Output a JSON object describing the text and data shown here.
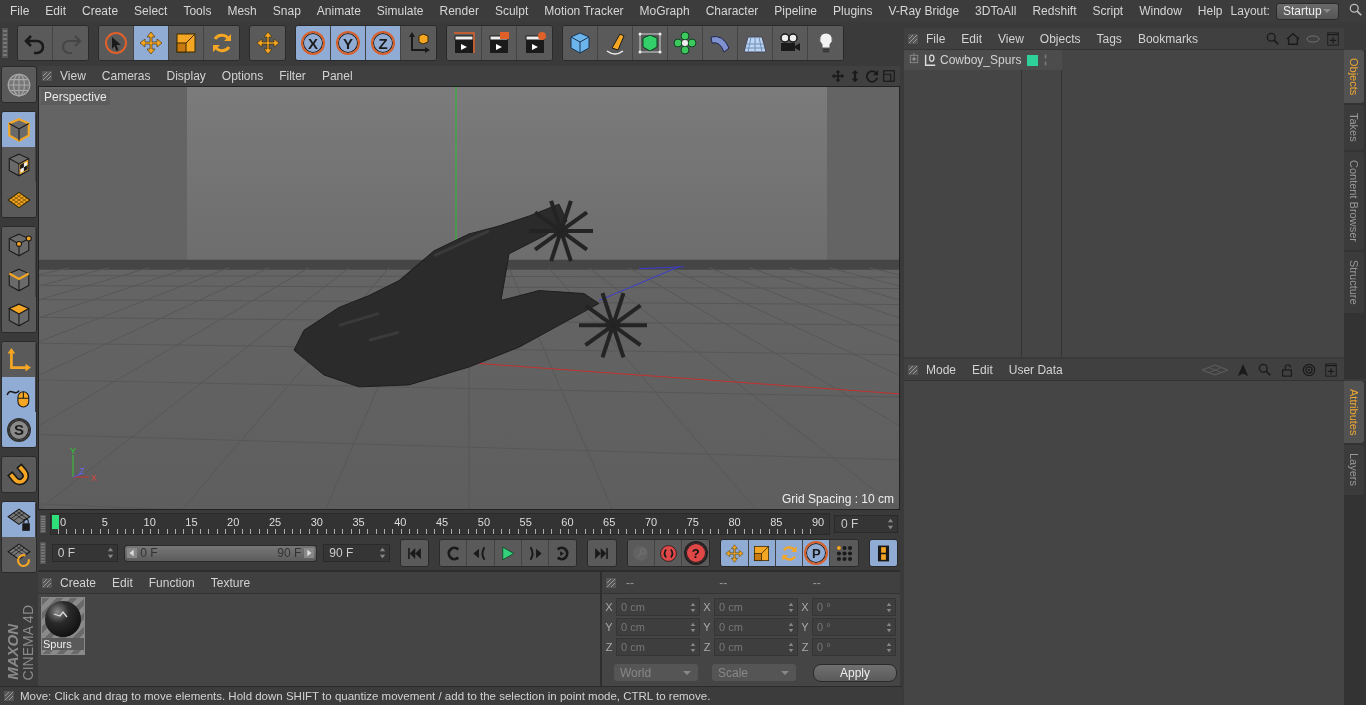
{
  "menu_bar": {
    "items": [
      "File",
      "Edit",
      "Create",
      "Select",
      "Tools",
      "Mesh",
      "Snap",
      "Animate",
      "Simulate",
      "Render",
      "Sculpt",
      "Motion Tracker",
      "MoGraph",
      "Character",
      "Pipeline",
      "Plugins",
      "V-Ray Bridge",
      "3DToAll",
      "Redshift",
      "Script",
      "Window",
      "Help"
    ],
    "layout_label": "Layout:",
    "layout_value": "Startup"
  },
  "toolbar": {
    "groups": [
      {
        "items": [
          {
            "kind": "undo",
            "selected": false,
            "disabled": false
          },
          {
            "kind": "redo",
            "selected": false,
            "disabled": true
          }
        ]
      },
      {
        "items": [
          {
            "kind": "select",
            "selected": false,
            "disabled": false
          },
          {
            "kind": "move",
            "selected": true,
            "disabled": false
          },
          {
            "kind": "scale",
            "selected": false,
            "disabled": false
          },
          {
            "kind": "rotate",
            "selected": false,
            "disabled": false
          }
        ]
      },
      {
        "items": [
          {
            "kind": "move",
            "selected": false,
            "disabled": false
          }
        ]
      },
      {
        "items": [
          {
            "kind": "letter",
            "label": "X",
            "selected": true,
            "disabled": false
          },
          {
            "kind": "letter",
            "label": "Y",
            "selected": true,
            "disabled": false
          },
          {
            "kind": "letter",
            "label": "Z",
            "selected": true,
            "disabled": false
          },
          {
            "kind": "coord",
            "selected": false,
            "disabled": false
          }
        ]
      },
      {
        "items": [
          {
            "kind": "render_view",
            "selected": false,
            "disabled": false
          },
          {
            "kind": "render_pv",
            "selected": false,
            "disabled": false
          },
          {
            "kind": "render_set",
            "selected": false,
            "disabled": false
          }
        ]
      },
      {
        "items": [
          {
            "kind": "cube",
            "selected": false,
            "disabled": false
          },
          {
            "kind": "pen",
            "selected": false,
            "disabled": false
          },
          {
            "kind": "cage",
            "selected": false,
            "disabled": false
          },
          {
            "kind": "cloner",
            "selected": false,
            "disabled": false
          },
          {
            "kind": "bend",
            "selected": false,
            "disabled": false
          },
          {
            "kind": "floor",
            "selected": false,
            "disabled": false
          },
          {
            "kind": "camera",
            "selected": false,
            "disabled": false
          },
          {
            "kind": "light",
            "selected": false,
            "disabled": false
          }
        ]
      }
    ]
  },
  "tool_strip": {
    "groups": [
      {
        "items": [
          {
            "kind": "sphere",
            "selected": false,
            "disabled": false
          }
        ]
      },
      {
        "items": [
          {
            "kind": "model",
            "selected": true,
            "disabled": false
          },
          {
            "kind": "texture",
            "selected": false,
            "disabled": false
          },
          {
            "kind": "workplane",
            "selected": false,
            "disabled": false
          }
        ]
      },
      {
        "items": [
          {
            "kind": "points",
            "selected": false,
            "disabled": false
          },
          {
            "kind": "edges",
            "selected": false,
            "disabled": false
          },
          {
            "kind": "polys",
            "selected": false,
            "disabled": false
          }
        ]
      },
      {
        "items": [
          {
            "kind": "axis",
            "selected": false,
            "disabled": false
          },
          {
            "kind": "tweak",
            "selected": true,
            "disabled": false
          },
          {
            "kind": "snap",
            "label": "S",
            "selected": true,
            "disabled": false
          }
        ]
      },
      {
        "items": [
          {
            "kind": "magnet",
            "selected": false,
            "disabled": false
          }
        ]
      },
      {
        "items": [
          {
            "kind": "gridlock",
            "selected": true,
            "disabled": false
          },
          {
            "kind": "gridrot",
            "selected": false,
            "disabled": false
          }
        ]
      }
    ]
  },
  "viewport": {
    "menu": [
      "View",
      "Cameras",
      "Display",
      "Options",
      "Filter",
      "Panel"
    ],
    "camera_label": "Perspective",
    "grid_spacing": "Grid Spacing : 10 cm",
    "gizmo_labels": [
      "Y",
      "Z",
      "X"
    ]
  },
  "timeline": {
    "ticks": [
      "0",
      "5",
      "10",
      "15",
      "20",
      "25",
      "30",
      "35",
      "40",
      "45",
      "50",
      "55",
      "60",
      "65",
      "70",
      "75",
      "80",
      "85",
      "90"
    ],
    "level": 0,
    "current_frame": "0 F"
  },
  "transport": {
    "start_field": "0 F",
    "range": {
      "start": "0 F",
      "end": "90 F",
      "level": 1
    },
    "end_field": "90 F",
    "groups": [
      {
        "items": [
          {
            "kind": "skip_start",
            "selected": false,
            "disabled": false
          }
        ]
      },
      {
        "items": [
          {
            "kind": "prev_key",
            "selected": false,
            "disabled": false
          },
          {
            "kind": "prev_frame",
            "selected": false,
            "disabled": false
          },
          {
            "kind": "play",
            "selected": false,
            "disabled": false
          },
          {
            "kind": "next_frame",
            "selected": false,
            "disabled": false
          },
          {
            "kind": "next_key",
            "selected": false,
            "disabled": false
          }
        ]
      },
      {
        "items": [
          {
            "kind": "skip_end",
            "selected": false,
            "disabled": false
          }
        ]
      },
      {
        "items": [
          {
            "kind": "key",
            "selected": false,
            "disabled": true
          },
          {
            "kind": "record",
            "selected": false,
            "disabled": false
          },
          {
            "kind": "help",
            "label": "?",
            "selected": false,
            "disabled": false
          }
        ]
      },
      {
        "items": [
          {
            "kind": "move",
            "selected": true,
            "disabled": false
          },
          {
            "kind": "scale",
            "selected": true,
            "disabled": false
          },
          {
            "kind": "rotate",
            "selected": true,
            "disabled": false
          },
          {
            "kind": "letter",
            "label": "P",
            "selected": true,
            "disabled": false
          },
          {
            "kind": "dots",
            "selected": false,
            "disabled": false
          }
        ]
      },
      {
        "items": [
          {
            "kind": "film",
            "selected": true,
            "disabled": false
          }
        ]
      }
    ]
  },
  "material_manager": {
    "menu": [
      "Create",
      "Edit",
      "Function",
      "Texture"
    ],
    "materials": [
      {
        "name": "Spurs"
      }
    ]
  },
  "coordinates": {
    "headers": [
      "--",
      "--",
      "--"
    ],
    "rows": [
      {
        "cells": [
          {
            "axis": "X",
            "value": "0 cm"
          },
          {
            "axis": "X",
            "value": "0 cm"
          },
          {
            "axis": "X",
            "value": "0 °"
          }
        ]
      },
      {
        "cells": [
          {
            "axis": "Y",
            "value": "0 cm"
          },
          {
            "axis": "Y",
            "value": "0 cm"
          },
          {
            "axis": "Y",
            "value": "0 °"
          }
        ]
      },
      {
        "cells": [
          {
            "axis": "Z",
            "value": "0 cm"
          },
          {
            "axis": "Z",
            "value": "0 cm"
          },
          {
            "axis": "Z",
            "value": "0 °"
          }
        ]
      }
    ],
    "dropdowns": [
      "World",
      "Scale"
    ],
    "apply": "Apply"
  },
  "object_manager": {
    "menu": [
      "File",
      "Edit",
      "View",
      "Objects",
      "Tags",
      "Bookmarks"
    ],
    "objects": [
      {
        "name": "Cowboy_Spurs",
        "expanded": false,
        "color": "#2ed19a"
      }
    ]
  },
  "attribute_manager": {
    "menu": [
      "Mode",
      "Edit",
      "User Data"
    ]
  },
  "side_tabs": {
    "upper": [
      {
        "label": "Objects",
        "selected": true
      },
      {
        "label": "Takes",
        "selected": false
      },
      {
        "label": "Content Browser",
        "selected": false
      },
      {
        "label": "Structure",
        "selected": false
      }
    ],
    "lower": [
      {
        "label": "Attributes",
        "selected": true
      },
      {
        "label": "Layers",
        "selected": false
      }
    ]
  },
  "logo": {
    "brand": "MAXON",
    "product": "CINEMA 4D"
  },
  "status_bar": "Move: Click and drag to move elements. Hold down SHIFT to quantize movement / add to the selection in point mode, CTRL to remove."
}
